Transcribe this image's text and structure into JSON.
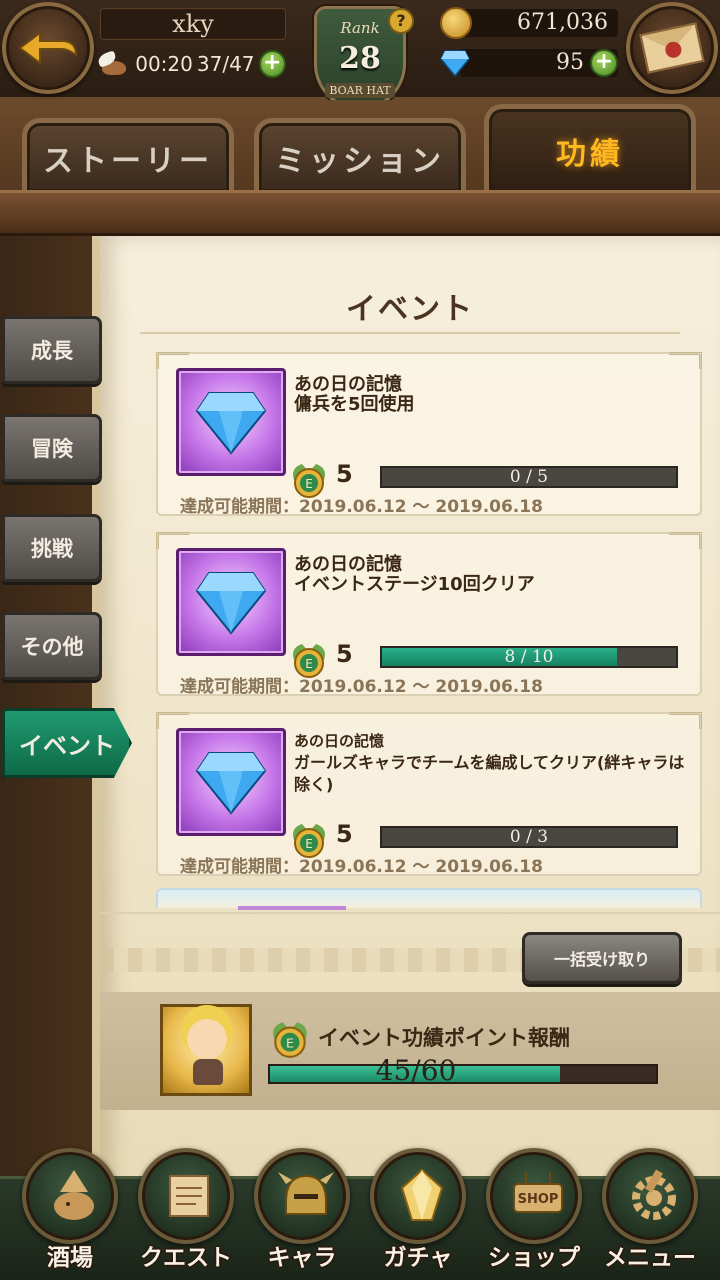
{
  "player": {
    "name": "xky",
    "stamina_timer": "00:20",
    "stamina": "37/47",
    "rank_label": "Rank",
    "rank": "28",
    "rank_title": "BOAR HAT",
    "gold": "671,036",
    "gems": "95"
  },
  "tabs": [
    "ストーリー",
    "ミッション",
    "功績"
  ],
  "active_tab": "功績",
  "side_tabs": [
    "成長",
    "冒険",
    "挑戦",
    "その他",
    "イベント"
  ],
  "active_side_tab": "イベント",
  "panel": {
    "title": "イベント",
    "period_label": "達成可能期間：2019.06.12 ～ 2019.06.18",
    "bulk_claim": "一括受け取り"
  },
  "achievements": [
    {
      "name": "あの日の記憶",
      "description": "傭兵を5回使用",
      "reward": "5",
      "progress_text": "0 / 5",
      "progress": 0.0,
      "period": "達成可能期間：2019.06.12 ～ 2019.06.18"
    },
    {
      "name": "あの日の記憶",
      "description": "イベントステージ10回クリア",
      "reward": "5",
      "progress_text": "8 / 10",
      "progress": 0.8,
      "period": "達成可能期間：2019.06.12 ～ 2019.06.18"
    },
    {
      "name": "あの日の記憶",
      "description": "ガールズキャラでチームを編成してクリア(絆キャラは除く)",
      "reward": "5",
      "progress_text": "0 / 3",
      "progress": 0.0,
      "period": "達成可能期間：2019.06.12 ～ 2019.06.18"
    }
  ],
  "event_reward": {
    "title": "イベント功績ポイント報酬",
    "progress_text": "45/60",
    "progress": 0.75
  },
  "bottom_nav": [
    "酒場",
    "クエスト",
    "キャラ",
    "ガチャ",
    "ショップ",
    "メニュー"
  ],
  "colors": {
    "accent_green": "#1f9a70",
    "active_tab_text": "#ffb820",
    "gem_blue": "#3ea8f0",
    "item_frame_purple": "#c576e8"
  },
  "icons": {
    "back": "back-arrow-icon",
    "mail": "mail-icon",
    "stamina": "wing-boot-icon",
    "gold": "gold-coin-icon",
    "gem": "gem-icon",
    "help": "question-icon",
    "medal": "event-medal-icon"
  }
}
